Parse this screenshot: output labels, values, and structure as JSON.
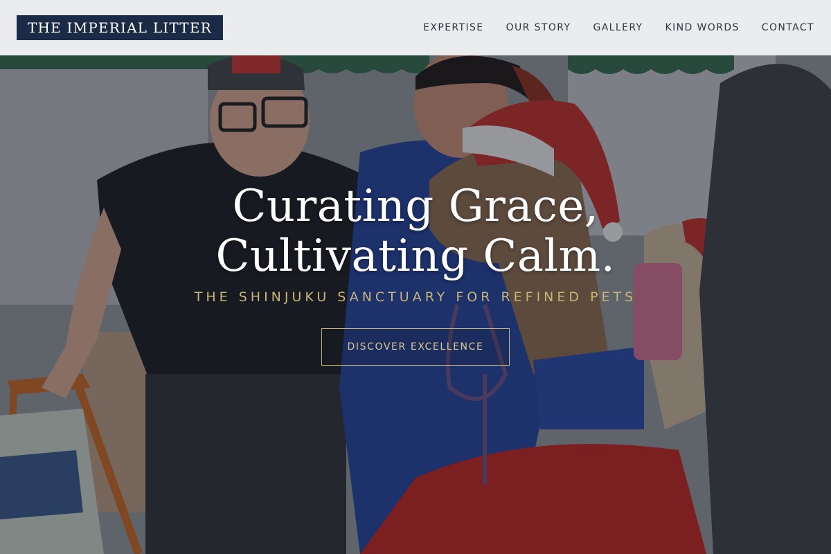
{
  "header": {
    "logo_text": "THE IMPERIAL LITTER",
    "nav": [
      {
        "label": "EXPERTISE"
      },
      {
        "label": "OUR STORY"
      },
      {
        "label": "GALLERY"
      },
      {
        "label": "KIND WORDS"
      },
      {
        "label": "CONTACT"
      }
    ]
  },
  "hero": {
    "title_line1": "Curating Grace,",
    "title_line2": "Cultivating Calm.",
    "subtitle": "THE SHINJUKU SANCTUARY FOR REFINED PETS",
    "cta_label": "DISCOVER EXCELLENCE",
    "background_description_icon": "hero-photo"
  },
  "colors": {
    "logo_bg": "#1b2a45",
    "accent_gold": "#c8b577",
    "header_bg": "#f5f6f7",
    "nav_text": "#2e3440"
  }
}
